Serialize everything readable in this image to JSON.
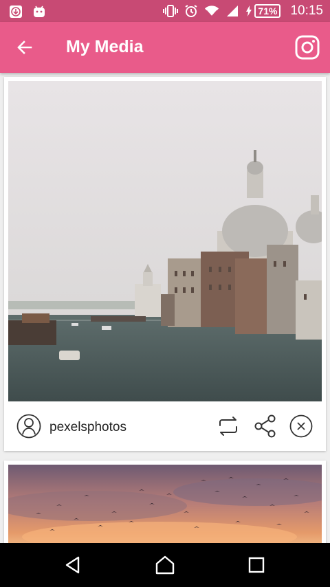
{
  "status_bar": {
    "time": "10:15",
    "battery": "71%",
    "icons": [
      "download-icon",
      "android-icon",
      "vibrate-icon",
      "alarm-icon",
      "wifi-icon",
      "signal-icon",
      "charging-icon"
    ]
  },
  "app_bar": {
    "title": "My Media",
    "back_icon": "arrow-left-icon",
    "action_icon": "instagram-icon"
  },
  "posts": [
    {
      "username": "pexelsphotos",
      "image": "venice-grand-canal-photo",
      "actions": [
        "repost-icon",
        "share-icon",
        "close-circle-icon"
      ]
    },
    {
      "image": "sunset-birds-photo"
    }
  ],
  "nav_bar": {
    "buttons": [
      "back-triangle-icon",
      "home-icon",
      "recents-icon"
    ]
  },
  "colors": {
    "status_bar": "#c84a74",
    "app_bar": "#e95b8a",
    "background": "#efefef",
    "card": "#ffffff"
  }
}
